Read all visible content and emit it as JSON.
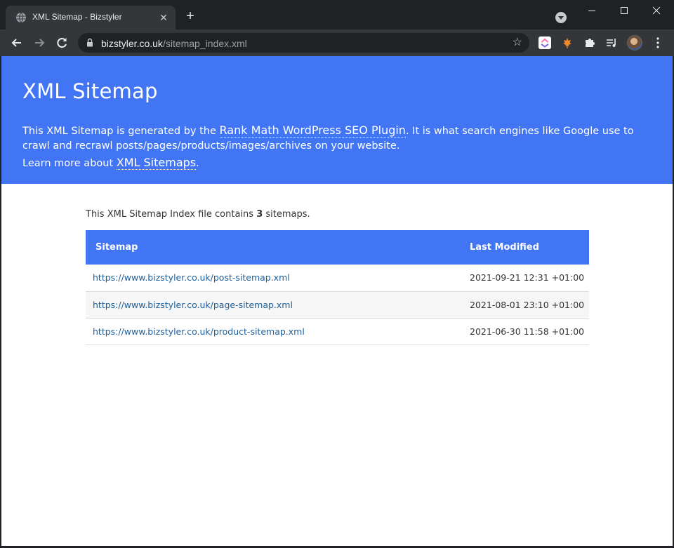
{
  "browser": {
    "tab_title": "XML Sitemap - Bizstyler",
    "url_host": "bizstyler.co.uk",
    "url_path": "/sitemap_index.xml",
    "tab_close_glyph": "✕",
    "new_tab_glyph": "+",
    "star_glyph": "☆"
  },
  "hero": {
    "title": "XML Sitemap",
    "desc_before": "This XML Sitemap is generated by the ",
    "desc_link": "Rank Math WordPress SEO Plugin",
    "desc_after": ". It is what search engines like Google use to crawl and recrawl posts/pages/products/images/archives on your website.",
    "learn_before": "Learn more about ",
    "learn_link": "XML Sitemaps",
    "learn_after": "."
  },
  "summary": {
    "before": "This XML Sitemap Index file contains ",
    "count": "3",
    "after": " sitemaps."
  },
  "table": {
    "headers": {
      "sitemap": "Sitemap",
      "last_modified": "Last Modified"
    },
    "rows": [
      {
        "url": "https://www.bizstyler.co.uk/post-sitemap.xml",
        "modified": "2021-09-21 12:31 +01:00"
      },
      {
        "url": "https://www.bizstyler.co.uk/page-sitemap.xml",
        "modified": "2021-08-01 23:10 +01:00"
      },
      {
        "url": "https://www.bizstyler.co.uk/product-sitemap.xml",
        "modified": "2021-06-30 11:58 +01:00"
      }
    ]
  },
  "colors": {
    "accent": "#4275f4",
    "link": "#20609a",
    "chrome_dark": "#202124",
    "chrome_toolbar": "#35363a"
  }
}
